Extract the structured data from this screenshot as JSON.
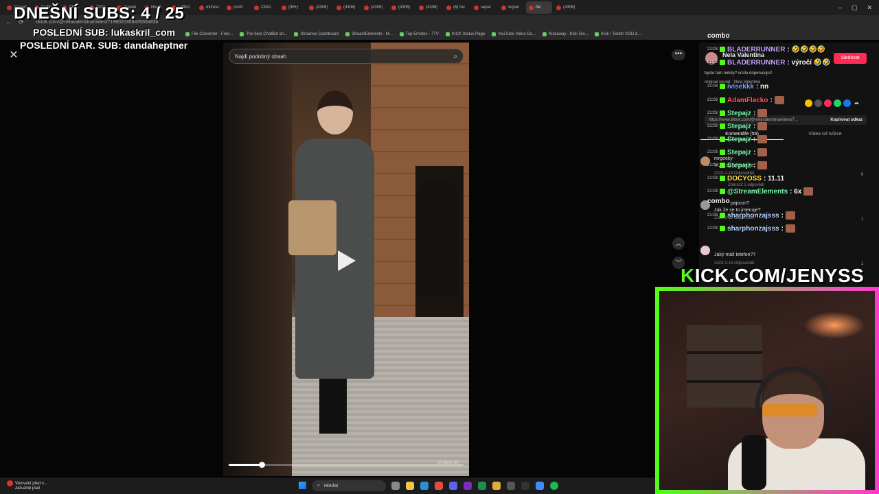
{
  "overlay": {
    "subs_count": "DNEŠNÍ SUBS: 4 / 25",
    "last_sub": "POSLEDNÍ SUB: lukaskril_com",
    "last_gift_sub": "POSLEDNÍ DAR. SUB: dandaheptner",
    "kick_url_k": "K",
    "kick_url_rest": "ICK.COM/JENYSS"
  },
  "browser": {
    "tabs": [
      "Stream",
      "Betfin",
      "ChfV..",
      "ChfV..",
      "Kuwan",
      "Havlíl",
      "w3W1",
      "miZosc",
      "profil",
      "CIGA",
      "(99+)",
      "(4306)",
      "(4306)",
      "(4306)",
      "(4306)",
      "(4306)",
      "(6) Inc",
      "separ",
      "vojtan",
      "Nc",
      "(4306)"
    ],
    "url": "tiktok.com/@nelavalentiina/video/7196020308435664838",
    "bookmarks": [
      "File Converter - Free...",
      "The best ChatBot an...",
      "Streamer Dashboard",
      "StreamElements - M...",
      "Top Emotes - 7TV",
      "KICK Status Page",
      "YouTube Video Do...",
      "Kickaway - Kick Giv...",
      "Kick / Twitch VOD d..."
    ]
  },
  "tiktok": {
    "search_placeholder": "Najdi podobný obsah",
    "time": "00:06/00:44",
    "progress_fraction": 0.14,
    "creator_name": "Nela Valentina",
    "follow_label": "Sledovat",
    "description": "byste tam nekdy? urcite doporucuju!!",
    "sound": "original sound - Nela Valentina",
    "link": "https://www.tiktok.com/@nelavalentiina/video/7...",
    "copy_link": "Kopírovat odkaz",
    "tab_comments": "Komentáře (55)",
    "tab_creator": "Videa od tvůrce",
    "comments": [
      {
        "user": "mrgeeky",
        "text": "Ví, ki se jako ta fot..",
        "meta": "2023-2-13 Odpovědět",
        "likes": "0"
      },
      {
        "user": "Zobrazit 2 odpovědi",
        "text": "",
        "meta": "",
        "likes": ""
      },
      {
        "user": "papcun?",
        "text": "Jak že se to jmenuje?",
        "meta": "2023-2-13 Odpovědět",
        "likes": "1"
      },
      {
        "user": "",
        "text": "Jaký máš telefon??",
        "meta": "2023-2-13 Odpovědět",
        "likes": "1"
      }
    ]
  },
  "chat": {
    "combo_top": "combo",
    "combo_mid": "combo",
    "lines": [
      {
        "ts": "21:03",
        "user": "BLADERRUNNER",
        "msg": ": 🤣🤣🤣🤣",
        "color": "#c8a8ff"
      },
      {
        "ts": "21:03",
        "user": "BLADERRUNNER",
        "msg": ": výročí 🤣🤣",
        "color": "#c8a8ff"
      },
      {
        "ts": "21:03",
        "user": "ivisekkk",
        "msg": ": nn",
        "color": "#7aa8ff"
      },
      {
        "ts": "21:03",
        "user": "AdamFlacko",
        "msg": ":",
        "color": "#ff5a5a"
      },
      {
        "ts": "21:03",
        "user": "Stepajz",
        "msg": ":",
        "color": "#7dffb0"
      },
      {
        "ts": "21:03",
        "user": "Stepajz",
        "msg": ":",
        "color": "#7dffb0"
      },
      {
        "ts": "21:03",
        "user": "Stepajz",
        "msg": ":",
        "color": "#7dffb0"
      },
      {
        "ts": "21:03",
        "user": "Stepajz",
        "msg": ":",
        "color": "#7dffb0"
      },
      {
        "ts": "21:03",
        "user": "Stepajz",
        "msg": ":",
        "color": "#7dffb0"
      },
      {
        "ts": "21:03",
        "user": "DOCYOSS",
        "msg": ": 11.11",
        "color": "#ffe14a"
      },
      {
        "ts": "21:03",
        "user": "@StreamElements",
        "msg": ": 6x",
        "color": "#7dffb0"
      },
      {
        "ts": "21:03",
        "user": "sharphonzajsss",
        "msg": ":",
        "color": "#b8d8ff"
      },
      {
        "ts": "21:03",
        "user": "sharphonzajsss",
        "msg": ":",
        "color": "#b8d8ff"
      }
    ]
  },
  "taskbar": {
    "weather_line1": "Varování před v...",
    "weather_line2": "Aktuálně platí",
    "search": "Hledat"
  },
  "colors": {
    "kick_green": "#53fc18",
    "tiktok_red": "#fe2c55",
    "cam_pink": "#ff3ad0"
  }
}
